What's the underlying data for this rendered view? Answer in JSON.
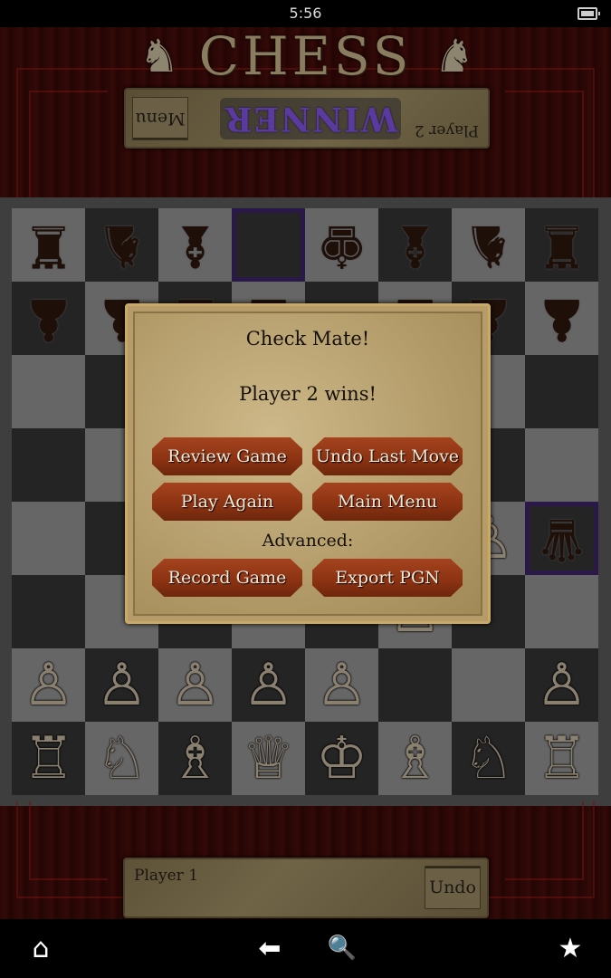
{
  "status_bar": {
    "time": "5:56",
    "battery_icon": "battery-full-icon"
  },
  "header": {
    "title": "CHESS",
    "logo_icon": "knight-icon"
  },
  "top_panel": {
    "player_label": "Player 2",
    "banner": "WINNER",
    "menu_button": "Menu",
    "orientation": "upside-down"
  },
  "board": {
    "highlight_squares": [
      [
        0,
        3
      ],
      [
        4,
        7
      ]
    ],
    "rows": [
      [
        "bR",
        "bN",
        "bB",
        "",
        "bK",
        "bB",
        "bN",
        "bR"
      ],
      [
        "bP",
        "bP",
        "bP",
        "bP",
        "",
        "bP",
        "bP",
        "bP"
      ],
      [
        "",
        "",
        "",
        "",
        "",
        "",
        "",
        ""
      ],
      [
        "",
        "",
        "",
        "",
        "",
        "",
        "",
        ""
      ],
      [
        "",
        "",
        "",
        "",
        "",
        "",
        "wP",
        "bQ"
      ],
      [
        "",
        "",
        "",
        "",
        "",
        "wP",
        "",
        ""
      ],
      [
        "wP",
        "wP",
        "wP",
        "wP",
        "wP",
        "",
        "",
        "wP"
      ],
      [
        "wR",
        "wN",
        "wB",
        "wQ",
        "wK",
        "wB",
        "wN",
        "wR"
      ]
    ],
    "glyphs": {
      "wK": "♔",
      "wQ": "♕",
      "wR": "♖",
      "wB": "♗",
      "wN": "♘",
      "wP": "♙",
      "bK": "♚",
      "bQ": "♛",
      "bR": "♜",
      "bB": "♝",
      "bN": "♞",
      "bP": "♟"
    }
  },
  "dialog": {
    "title": "Check Mate!",
    "message": "Player 2 wins!",
    "buttons": {
      "review_game": "Review Game",
      "undo_last_move": "Undo Last Move",
      "play_again": "Play Again",
      "main_menu": "Main Menu",
      "record_game": "Record Game",
      "export_pgn": "Export PGN"
    },
    "advanced_label": "Advanced:"
  },
  "bottom_panel": {
    "player_label": "Player 1",
    "undo_button": "Undo"
  },
  "nav": {
    "home": "⌂",
    "back": "⬅",
    "search": "🔍",
    "favorite": "★"
  }
}
